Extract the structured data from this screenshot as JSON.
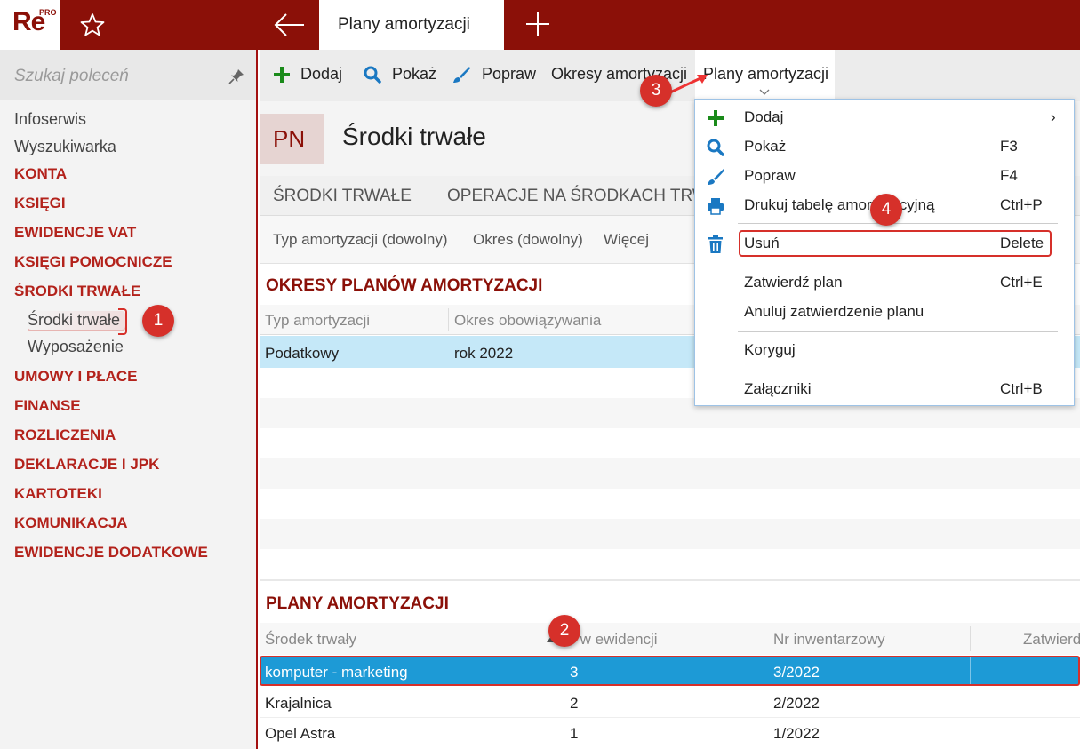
{
  "app": {
    "logo_text": "Re",
    "logo_sup": "PRO"
  },
  "tabs": {
    "active": "Plany amortyzacji"
  },
  "sidebar": {
    "search_placeholder": "Szukaj poleceń",
    "items": [
      {
        "label": "Infoserwis",
        "kind": "plain"
      },
      {
        "label": "Wyszukiwarka",
        "kind": "plain"
      },
      {
        "label": "KONTA",
        "kind": "section"
      },
      {
        "label": "KSIĘGI",
        "kind": "section"
      },
      {
        "label": "EWIDENCJE VAT",
        "kind": "section"
      },
      {
        "label": "KSIĘGI POMOCNICZE",
        "kind": "section"
      },
      {
        "label": "ŚRODKI TRWAŁE",
        "kind": "section"
      },
      {
        "label": "Środki trwałe",
        "kind": "sub",
        "selected": true
      },
      {
        "label": "Wyposażenie",
        "kind": "sub"
      },
      {
        "label": "UMOWY I PŁACE",
        "kind": "section"
      },
      {
        "label": "FINANSE",
        "kind": "section"
      },
      {
        "label": "ROZLICZENIA",
        "kind": "section"
      },
      {
        "label": "DEKLARACJE I JPK",
        "kind": "section"
      },
      {
        "label": "KARTOTEKI",
        "kind": "section"
      },
      {
        "label": "KOMUNIKACJA",
        "kind": "section"
      },
      {
        "label": "EWIDENCJE DODATKOWE",
        "kind": "section"
      }
    ]
  },
  "toolbar": {
    "add": "Dodaj",
    "show": "Pokaż",
    "edit": "Popraw",
    "periods": "Okresy amortyzacji",
    "plans": "Plany amortyzacji"
  },
  "header": {
    "badge": "PN",
    "title": "Środki trwałe"
  },
  "subtabs": [
    "ŚRODKI TRWAŁE",
    "OPERACJE NA ŚRODKACH TRWA"
  ],
  "filters": [
    "Typ amortyzacji (dowolny)",
    "Okres (dowolny)",
    "Więcej"
  ],
  "periods_section": {
    "title": "OKRESY PLANÓW AMORTYZACJI",
    "columns": [
      "Typ amortyzacji",
      "Okres obowiązywania"
    ],
    "rows": [
      [
        "Podatkowy",
        "rok 2022"
      ]
    ]
  },
  "plans_section": {
    "title": "PLANY AMORTYZACJI",
    "columns": [
      "Środek trwały",
      "Nr w ewidencji",
      "Nr inwentarzowy",
      "Zatwierd"
    ],
    "rows": [
      [
        "komputer - marketing",
        "3",
        "3/2022"
      ],
      [
        "Krajalnica",
        "2",
        "2/2022"
      ],
      [
        "Opel Astra",
        "1",
        "1/2022"
      ]
    ]
  },
  "menu": {
    "items": [
      {
        "label": "Dodaj",
        "shortcut": "›"
      },
      {
        "label": "Pokaż",
        "shortcut": "F3"
      },
      {
        "label": "Popraw",
        "shortcut": "F4"
      },
      {
        "label": "Drukuj tabelę amortyzacyjną",
        "shortcut": "Ctrl+P"
      },
      {
        "label": "Usuń",
        "shortcut": "Delete"
      },
      {
        "label": "Zatwierdź plan",
        "shortcut": "Ctrl+E"
      },
      {
        "label": "Anuluj zatwierdzenie planu",
        "shortcut": ""
      },
      {
        "label": "Koryguj",
        "shortcut": ""
      },
      {
        "label": "Załączniki",
        "shortcut": "Ctrl+B"
      }
    ]
  },
  "callouts": [
    "1",
    "2",
    "3",
    "4"
  ],
  "colors": {
    "brand": "#8b1008",
    "section": "#b3221b",
    "selected_row": "#1d9ad6",
    "light_row": "#c5e8f8",
    "callout": "#d6302a"
  }
}
